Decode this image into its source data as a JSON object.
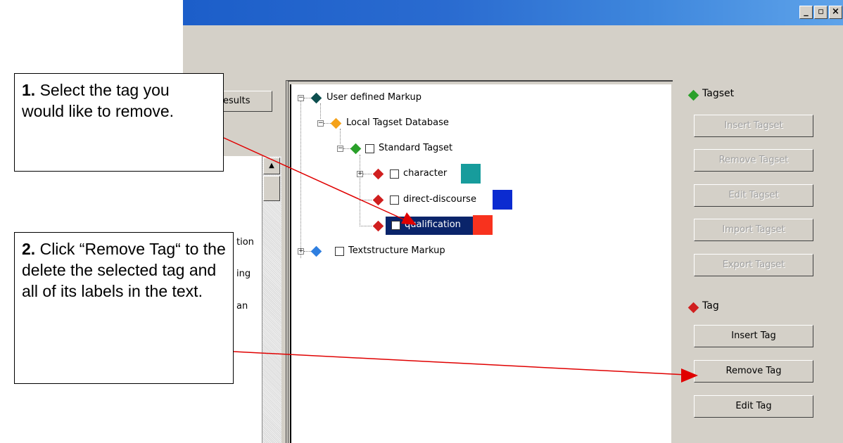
{
  "window": {
    "controls": {
      "minimize": "_",
      "maximize": "▫",
      "close": "×"
    }
  },
  "left_panel": {
    "results_button": "esults",
    "list_items": [
      "tion",
      "ing",
      "an"
    ]
  },
  "tree": {
    "root": "User defined Markup",
    "local_db": "Local Tagset Database",
    "tagset": "Standard Tagset",
    "tags": [
      {
        "label": "character",
        "color": "#179c9c"
      },
      {
        "label": "direct-discourse",
        "color": "#0b2bd0"
      },
      {
        "label": "qualification",
        "color": "#f8321e"
      }
    ],
    "textstructure": "Textstructure Markup",
    "icon_colors": {
      "root": "#0d4f4f",
      "local_db": "#f5a21a",
      "tagset": "#2aa02a",
      "tag": "#d01f1f",
      "textstructure": "#2f7fe0"
    }
  },
  "panel": {
    "tagset_heading": "Tagset",
    "tagset_buttons": [
      "Insert Tagset",
      "Remove Tagset",
      "Edit Tagset",
      "Import Tagset",
      "Export Tagset"
    ],
    "tag_heading": "Tag",
    "tag_buttons": [
      "Insert Tag",
      "Remove Tag",
      "Edit Tag"
    ]
  },
  "callouts": {
    "step1_num": "1.",
    "step1_text": " Select the tag you would like to remove.",
    "step2_num": "2.",
    "step2_text": " Click “Remove Tag“ to the delete the selected tag and all of its labels in the text."
  },
  "accent": {
    "selection": "#0a246a",
    "arrow": "#e00000"
  }
}
